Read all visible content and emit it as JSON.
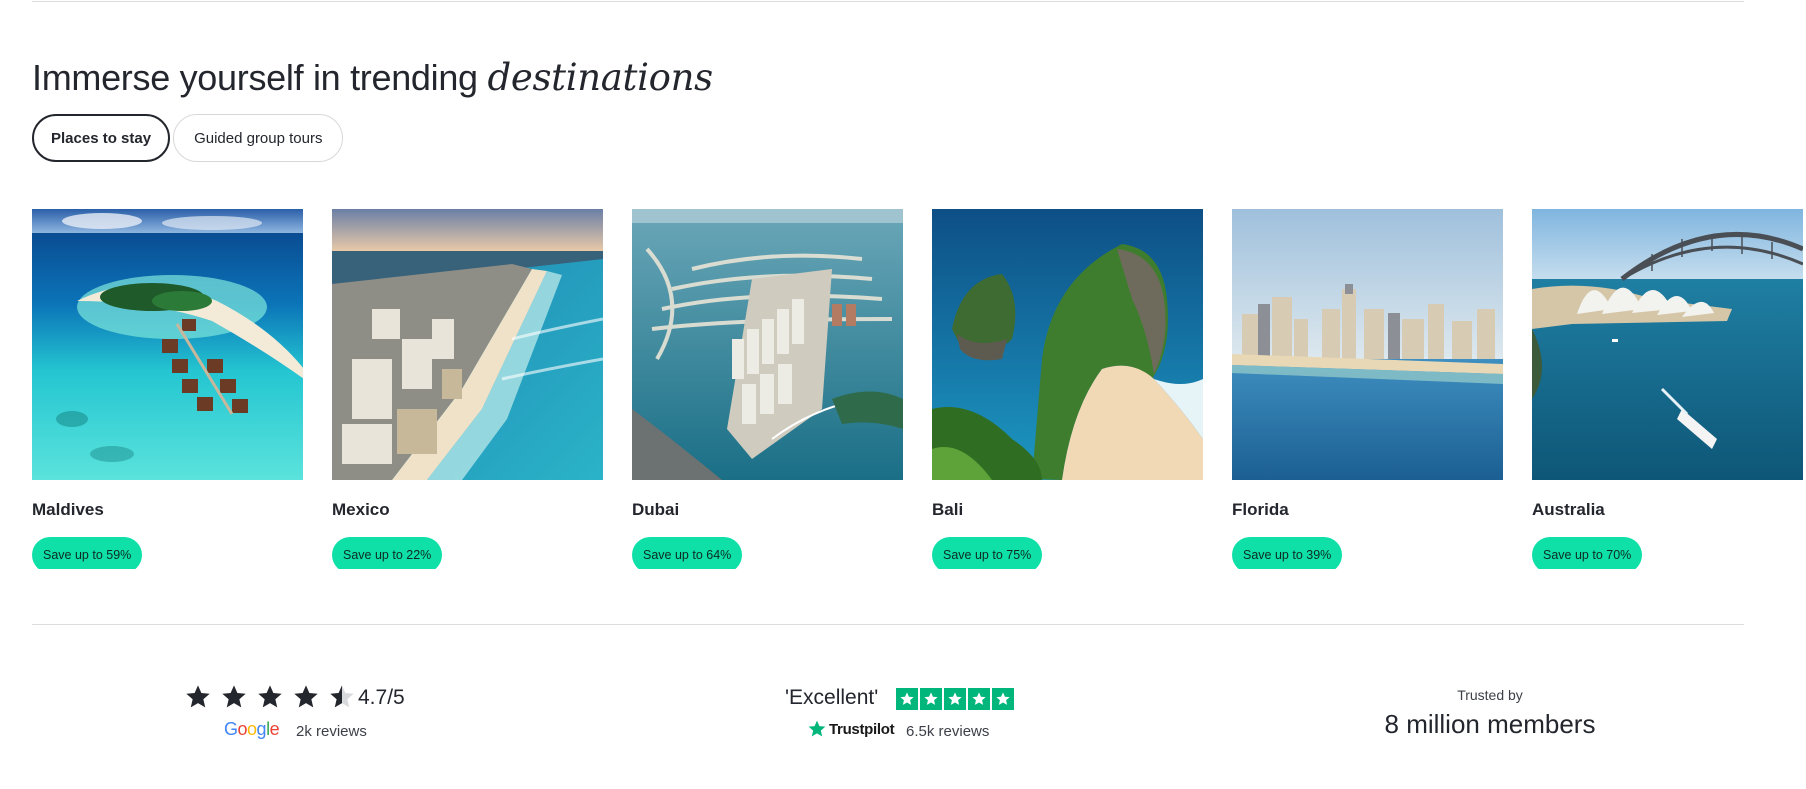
{
  "section": {
    "title_plain": "Immerse yourself in trending ",
    "title_accent": "destinations"
  },
  "tabs": [
    {
      "label": "Places to stay",
      "active": true
    },
    {
      "label": "Guided group tours",
      "active": false
    }
  ],
  "destinations": [
    {
      "name": "Maldives",
      "badge": "Save up to 59%"
    },
    {
      "name": "Mexico",
      "badge": "Save up to 22%"
    },
    {
      "name": "Dubai",
      "badge": "Save up to 64%"
    },
    {
      "name": "Bali",
      "badge": "Save up to 75%"
    },
    {
      "name": "Florida",
      "badge": "Save up to 39%"
    },
    {
      "name": "Australia",
      "badge": "Save up to 70%"
    }
  ],
  "reviews": {
    "google": {
      "rating": 4.7,
      "score_label": "4.7/5",
      "logo_text": "Google",
      "count_label": "2k reviews"
    },
    "trustpilot": {
      "label": "'Excellent'",
      "stars": 5,
      "logo_text": "Trustpilot",
      "count_label": "6.5k reviews"
    },
    "trusted": {
      "small_label": "Trusted by",
      "big_label": "8 million members"
    }
  },
  "colors": {
    "badge_bg": "#0fe0a8",
    "text_dark": "#23262d",
    "trustpilot_green": "#00b67a",
    "border": "#dcdcdc"
  }
}
